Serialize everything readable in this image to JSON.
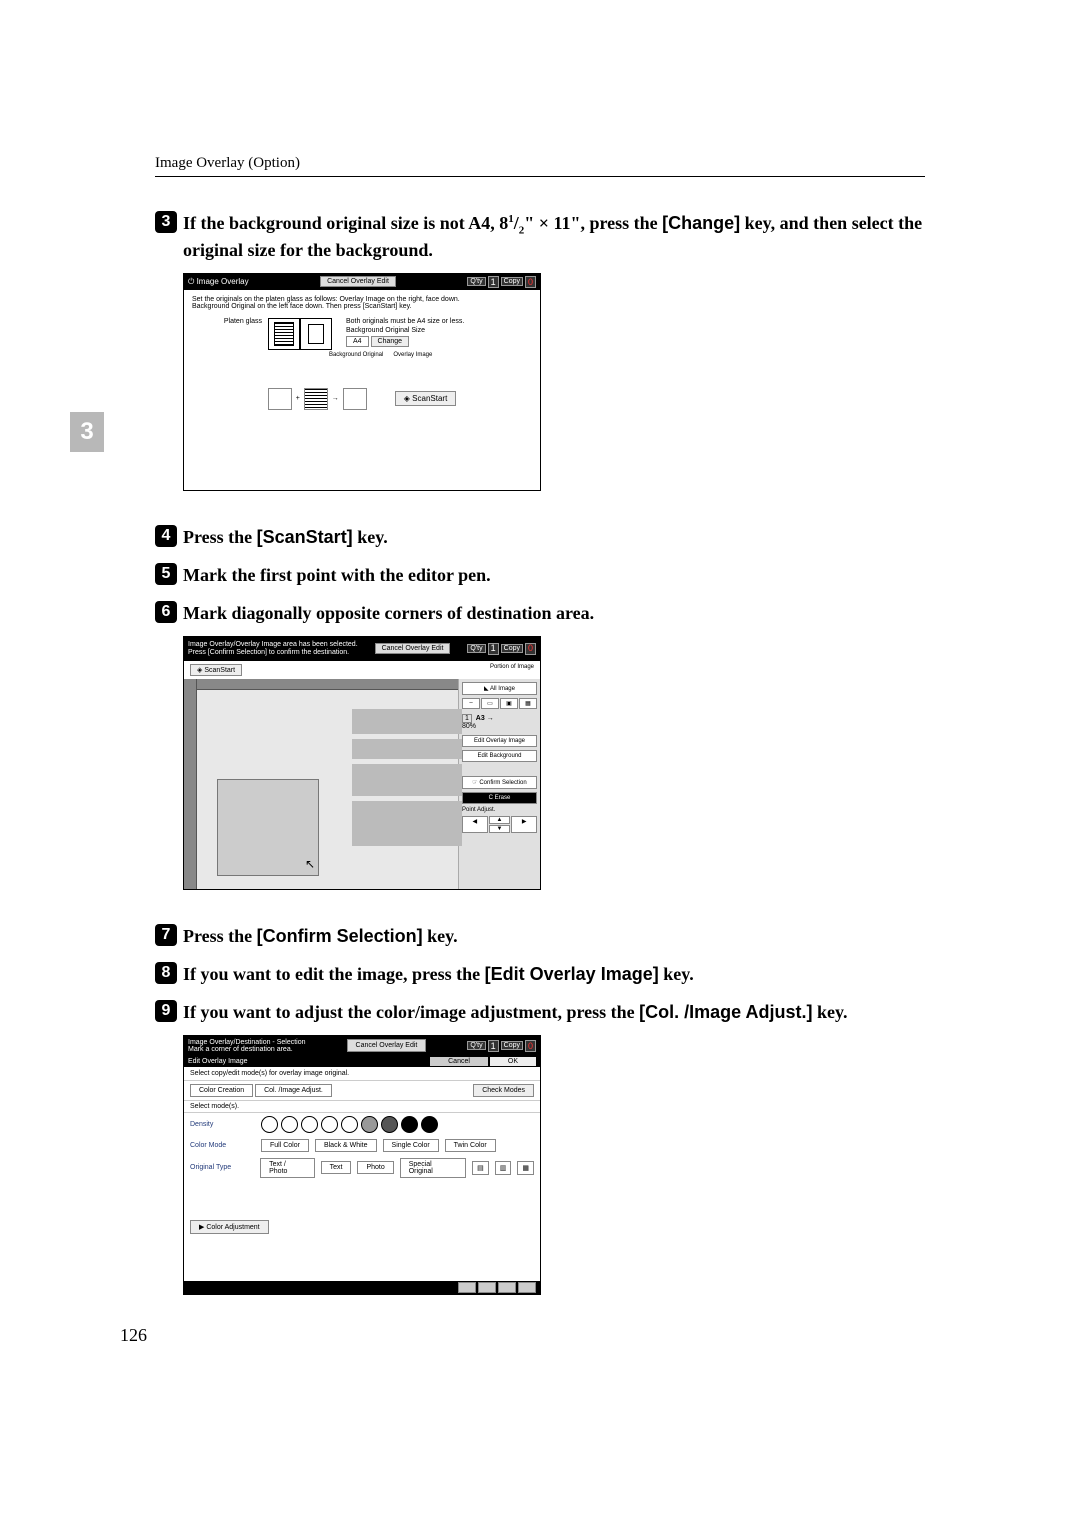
{
  "header": "Image Overlay (Option)",
  "pageNumber": "126",
  "sideTab": "3",
  "steps": {
    "s3": {
      "pre": "If the background original size is not A4, 8",
      "frac_num": "1",
      "frac_den": "2",
      "mid": "\" × 11\", press the ",
      "key": "[Change]",
      "post": " key, and then select the original size for the background."
    },
    "s4": {
      "pre": "Press the ",
      "key": "[ScanStart]",
      "post": " key."
    },
    "s5": {
      "text": "Mark the first point with the editor pen."
    },
    "s6": {
      "text": "Mark diagonally opposite corners of destination area."
    },
    "s7": {
      "pre": "Press the ",
      "key": "[Confirm Selection]",
      "post": " key."
    },
    "s8": {
      "pre": "If you want to edit the image, press the ",
      "key": "[Edit Overlay Image]",
      "post": " key."
    },
    "s9": {
      "pre": "If you want to adjust the color/image adjustment, press the ",
      "key": "[Col. /Image Adjust.]",
      "post": " key."
    }
  },
  "ss1": {
    "title": "Image Overlay",
    "cancel": "Cancel Overlay Edit",
    "qty": "Q'ty",
    "qtyVal": "1",
    "copy": "Copy",
    "copyVal": "0",
    "instr1": "Set the originals on the platen glass as follows: Overlay Image on the right, face down.",
    "instr2": "Background Original on the left face down. Then press [ScanStart] key.",
    "platen": "Platen glass",
    "bgorig": "Background Original",
    "ovimg": "Overlay Image",
    "note": "Both originals must be A4 size or less.",
    "bgsize": "Background Original Size",
    "a4": "A4",
    "change": "Change",
    "scanstart": "ScanStart"
  },
  "ss2": {
    "title1": "Image Overlay/Overlay Image area has been selected.",
    "title2": "Press [Confirm Selection] to confirm the destination.",
    "cancel": "Cancel Overlay Edit",
    "qty": "Q'ty",
    "qtyVal": "1",
    "copy": "Copy",
    "copyVal": "0",
    "scanstart": "ScanStart",
    "portion": "Portion of Image",
    "allimg": "All Image",
    "a3": "A3",
    "ratio": "80%",
    "editOverlay": "Edit Overlay Image",
    "editBg": "Edit Background",
    "confirm": "Confirm Selection",
    "erase": "Erase",
    "pointAdjust": "Point Adjust."
  },
  "ss3": {
    "title": "Image Overlay/Destination - Selection",
    "sub": "Mark a corner of destination area.",
    "cancel": "Cancel Overlay Edit",
    "qty": "Q'ty",
    "qtyVal": "1",
    "copy": "Copy",
    "copyVal": "0",
    "editOverlay": "Edit Overlay Image",
    "cancelBtn": "Cancel",
    "ok": "OK",
    "selectMsg": "Select copy/edit mode(s) for overlay image original.",
    "colorCreation": "Color Creation",
    "colImgAdj": "Col. /Image Adjust.",
    "checkModes": "Check Modes",
    "selectMode": "Select mode(s).",
    "density": "Density",
    "colorMode": "Color Mode",
    "fullColor": "Full Color",
    "bw": "Black & White",
    "singleColor": "Single Color",
    "twinColor": "Twin Color",
    "origType": "Original Type",
    "textPhoto": "Text / Photo",
    "text": "Text",
    "photo": "Photo",
    "special": "Special Original",
    "colorAdj": "Color Adjustment"
  }
}
